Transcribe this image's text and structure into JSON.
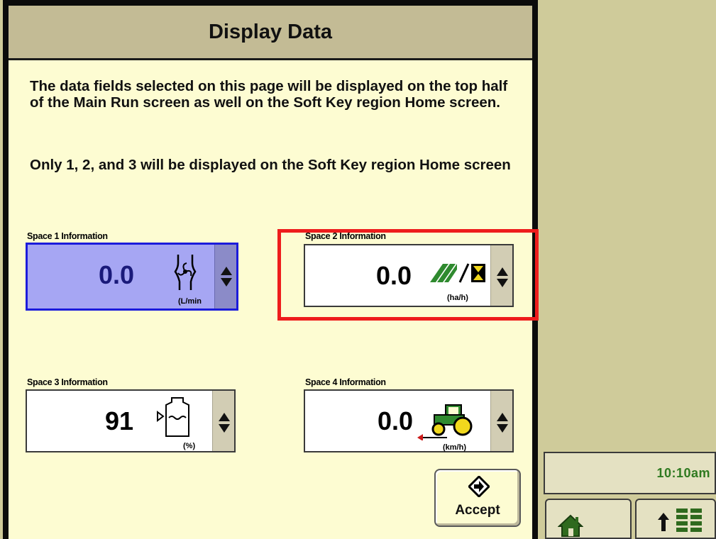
{
  "title": "Display Data",
  "description": "The data fields selected on this page will be displayed on the top half of the Main Run screen as well on the Soft Key region Home screen.",
  "note": "Only 1, 2, and 3 will be displayed on the Soft Key region Home screen",
  "spaces": [
    {
      "label": "Space 1 Information",
      "value": "0.0",
      "unit": "(L/min",
      "icon": "flow-rate-icon",
      "selected": true
    },
    {
      "label": "Space 2 Information",
      "value": "0.0",
      "unit": "(ha/h)",
      "icon": "area-per-hour-icon",
      "selected": false,
      "highlighted": true
    },
    {
      "label": "Space 3 Information",
      "value": "91",
      "unit": "(%)",
      "icon": "tank-level-icon",
      "selected": false
    },
    {
      "label": "Space 4 Information",
      "value": "0.0",
      "unit": "(km/h)",
      "icon": "tractor-speed-icon",
      "selected": false
    }
  ],
  "accept": {
    "label": "Accept",
    "icon": "accept-arrow-icon"
  },
  "clock": "10:10am",
  "softkeys": {
    "home_icon": "home-icon",
    "menu_icon": "menu-up-icon"
  },
  "colors": {
    "selected_fill": "#a6a6f3",
    "selected_border": "#1b1bdb",
    "highlight": "#ee1c1c",
    "clock_text": "#2f7a20",
    "background": "#fdfcd2"
  }
}
